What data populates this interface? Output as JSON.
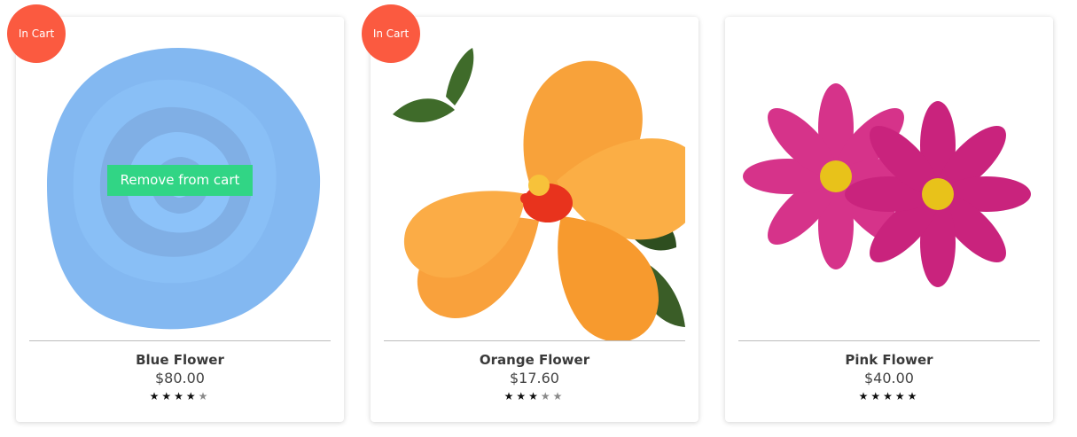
{
  "products": [
    {
      "name": "Blue Flower",
      "price": "$80.00",
      "rating": 4,
      "max_rating": 5,
      "badge": "In Cart",
      "action": "Remove from cart",
      "color": "#4a90e2"
    },
    {
      "name": "Orange Flower",
      "price": "$17.60",
      "rating": 3,
      "max_rating": 5,
      "badge": "In Cart",
      "color": "#f7931e"
    },
    {
      "name": "Pink Flower",
      "price": "$40.00",
      "rating": 5,
      "max_rating": 5,
      "color": "#d6338a"
    }
  ],
  "colors": {
    "badge": "#fb5a40",
    "remove_button": "#31d585",
    "divider": "#bdbdbd"
  }
}
